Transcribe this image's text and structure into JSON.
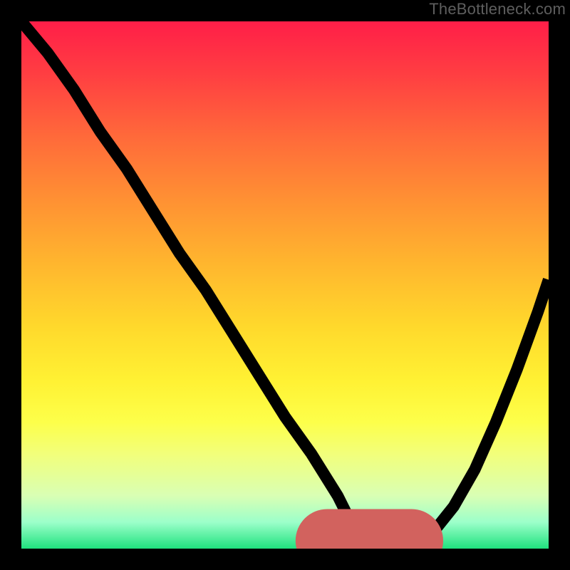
{
  "watermark": "TheBottleneck.com",
  "chart_data": {
    "type": "line",
    "title": "",
    "xlabel": "",
    "ylabel": "",
    "xlim": [
      0,
      100
    ],
    "ylim": [
      0,
      100
    ],
    "grid": false,
    "legend": false,
    "background_gradient": {
      "direction": "vertical",
      "stops": [
        {
          "pos": 0,
          "color": "#ff1e48"
        },
        {
          "pos": 50,
          "color": "#ffd92c"
        },
        {
          "pos": 80,
          "color": "#fdff4a"
        },
        {
          "pos": 100,
          "color": "#1fe27e"
        }
      ]
    },
    "series": [
      {
        "name": "bottleneck-curve",
        "color": "#000000",
        "x": [
          0,
          5,
          10,
          15,
          20,
          25,
          30,
          35,
          40,
          45,
          50,
          55,
          60,
          62,
          65,
          68,
          70,
          72,
          75,
          78,
          82,
          86,
          90,
          94,
          98,
          100
        ],
        "y": [
          100,
          94,
          87,
          79,
          72,
          64,
          56,
          49,
          41,
          33,
          25,
          18,
          10,
          6,
          3,
          1,
          0,
          0,
          1,
          3,
          8,
          15,
          24,
          34,
          45,
          51
        ]
      }
    ],
    "annotations": [
      {
        "name": "optimal-range-marker",
        "type": "segment",
        "color": "#d2625e",
        "x_start": 58,
        "x_end": 74,
        "y": 1.5,
        "end_dot": true
      }
    ]
  },
  "colors": {
    "frame": "#000000",
    "watermark": "#5e5e5e",
    "curve": "#000000",
    "marker": "#d2625e"
  }
}
